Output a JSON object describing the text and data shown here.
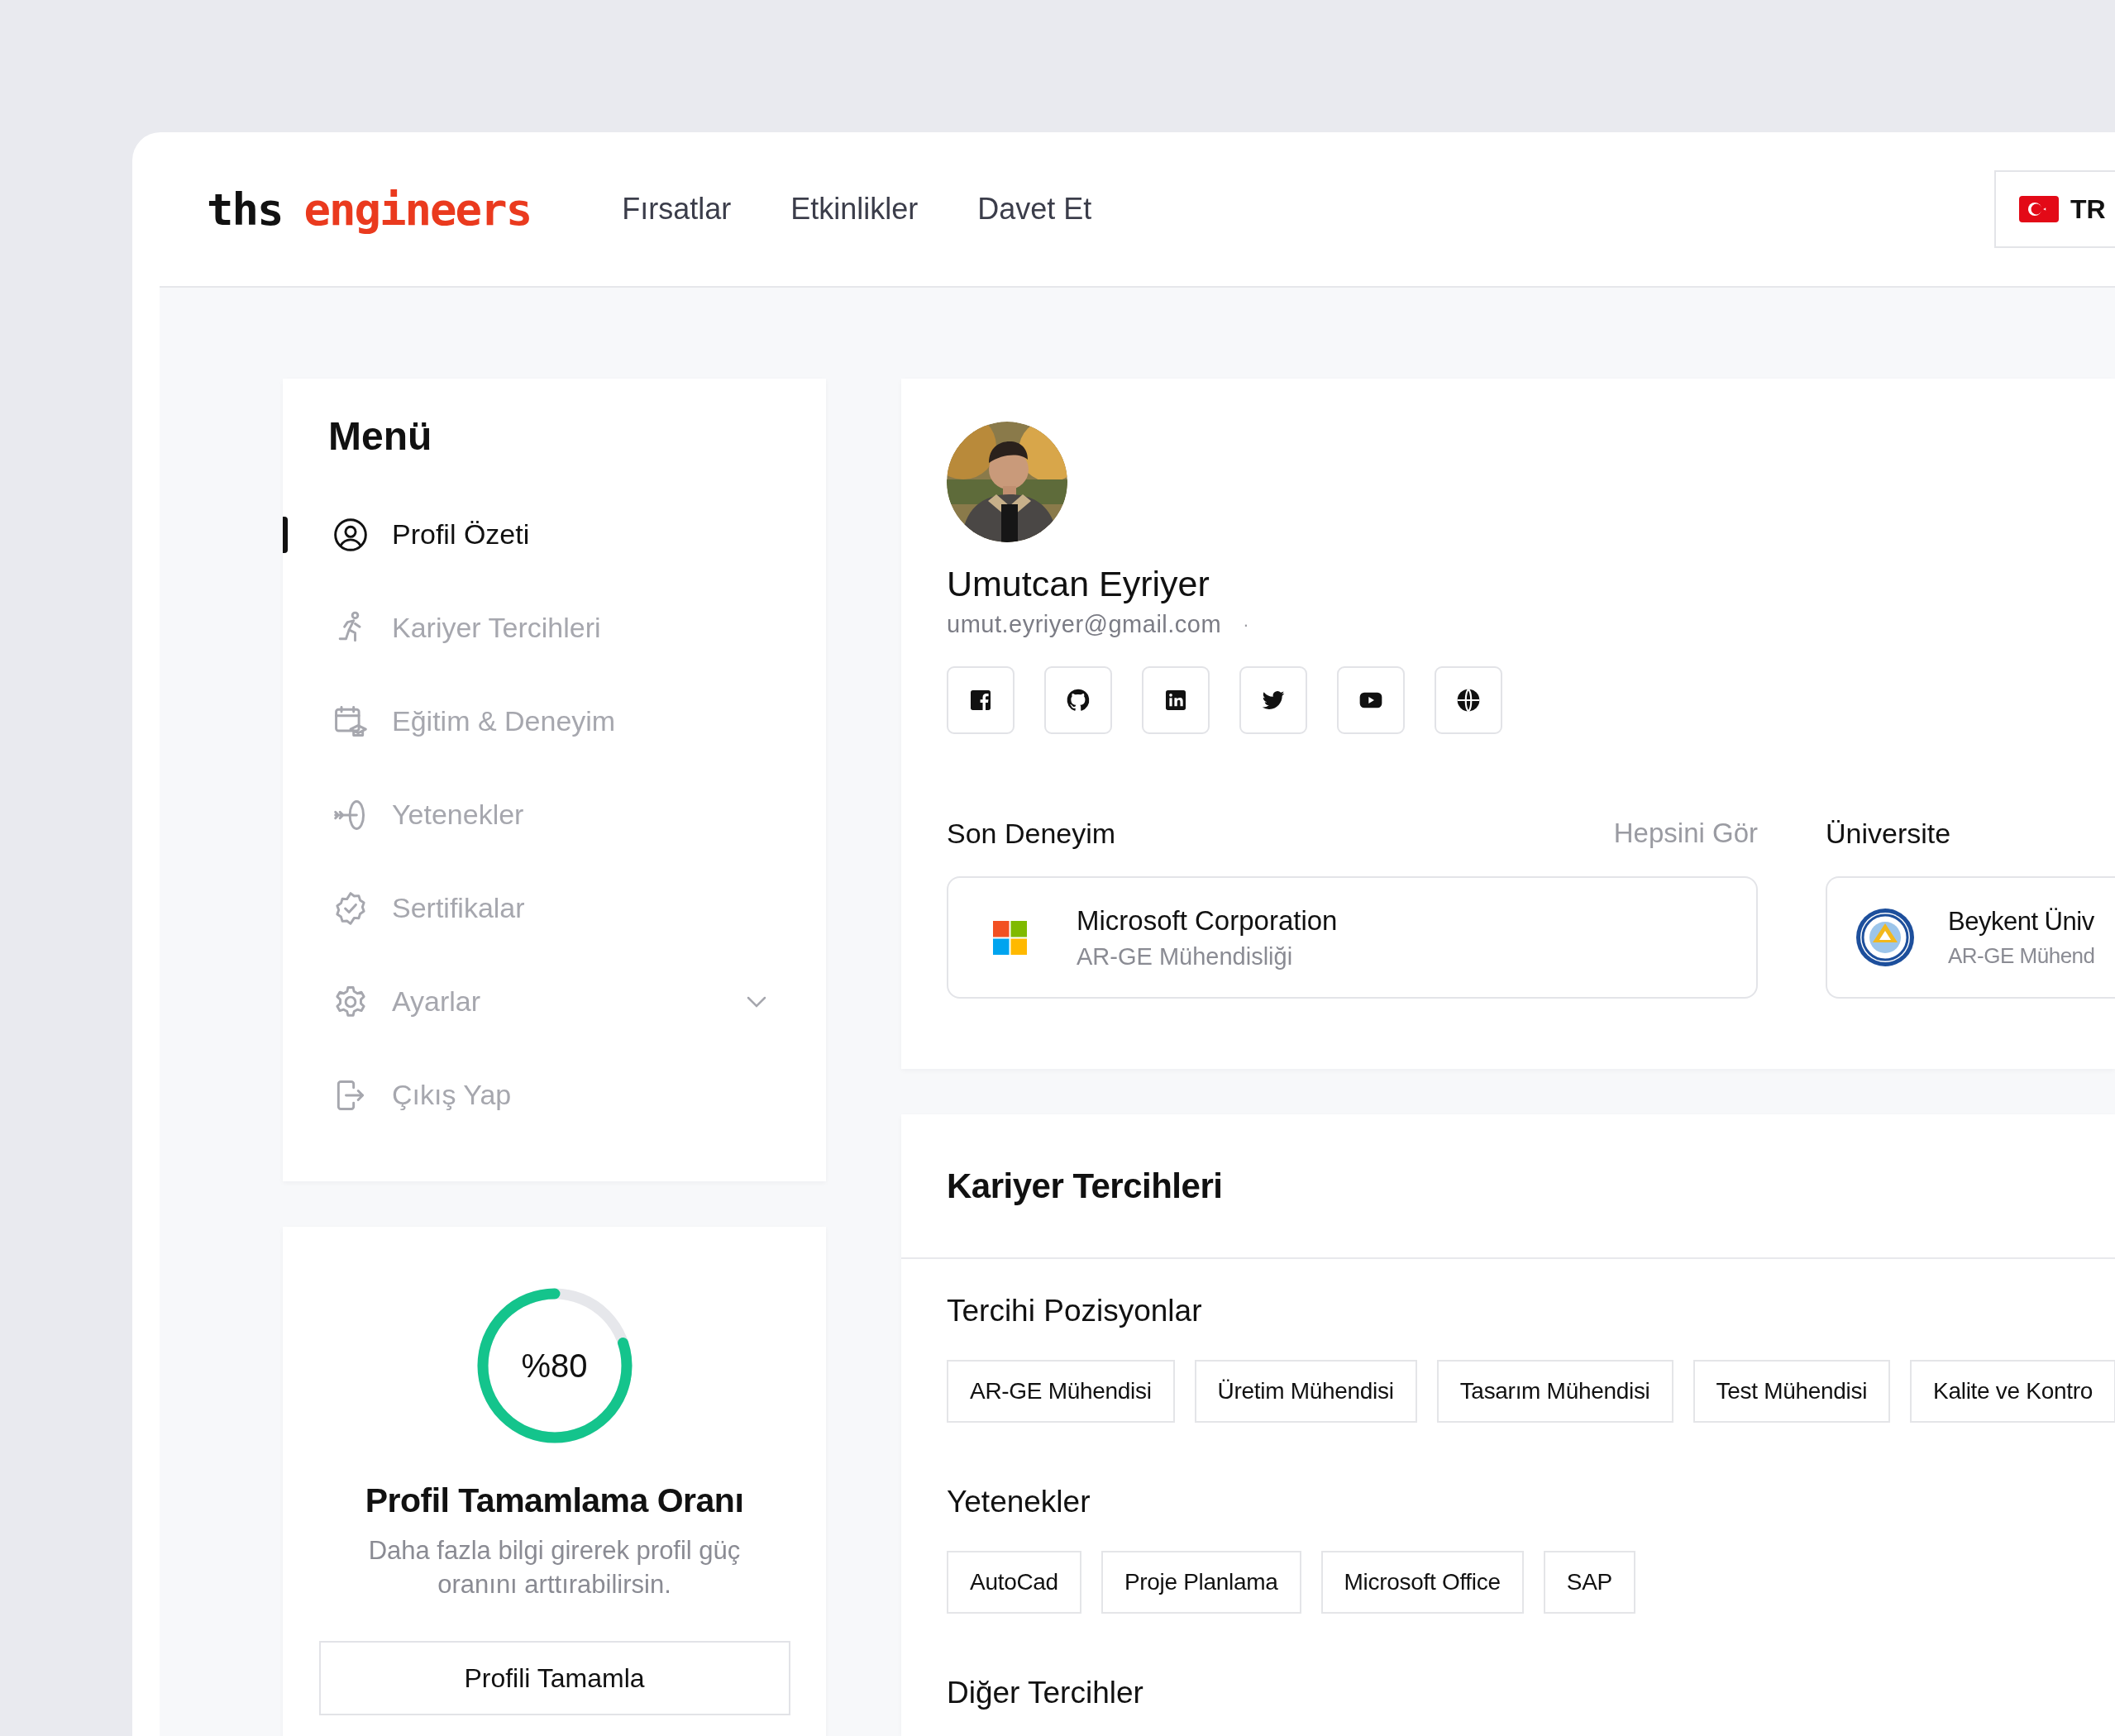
{
  "header": {
    "logo": {
      "prefix": "ths",
      "wordmark": "engineers"
    },
    "nav": [
      {
        "label": "Fırsatlar"
      },
      {
        "label": "Etkinlikler"
      },
      {
        "label": "Davet Et"
      }
    ],
    "language": {
      "code": "TR"
    }
  },
  "menu": {
    "title": "Menü",
    "items": [
      {
        "label": "Profil Özeti",
        "kind": "profile",
        "selected": true
      },
      {
        "label": "Kariyer Tercihleri",
        "kind": "career",
        "selected": false
      },
      {
        "label": "Eğitim & Deneyim",
        "kind": "education",
        "selected": false
      },
      {
        "label": "Yetenekler",
        "kind": "skills",
        "selected": false
      },
      {
        "label": "Sertifikalar",
        "kind": "certificates",
        "selected": false
      },
      {
        "label": "Ayarlar",
        "kind": "settings",
        "selected": false
      },
      {
        "label": "Çıkış Yap",
        "kind": "logout",
        "selected": false
      }
    ]
  },
  "completion": {
    "percent": "%80",
    "level": 0.8,
    "title": "Profil Tamamlama Oranı",
    "description": "Daha fazla bilgi girerek profil güç oranını arttırabilirsin.",
    "button": "Profili Tamamla"
  },
  "profile": {
    "name": "Umutcan Eyriyer",
    "email": "umut.eyriyer@gmail.com",
    "separator": "·",
    "social_links": [
      {
        "kind": "facebook"
      },
      {
        "kind": "github"
      },
      {
        "kind": "linkedin"
      },
      {
        "kind": "twitter"
      },
      {
        "kind": "youtube"
      },
      {
        "kind": "website"
      }
    ],
    "sections": [
      {
        "title": "Son Deneyim",
        "action": "Hepsini Gör",
        "card": {
          "kind": "company",
          "title": "Microsoft Corporation",
          "subtitle": "AR-GE Mühendisliği"
        }
      },
      {
        "title": "Üniversite",
        "card": {
          "kind": "university",
          "title": "Beykent Üniv",
          "subtitle": "AR-GE Mühend"
        }
      }
    ]
  },
  "career": {
    "title": "Kariyer Tercihleri",
    "groups": [
      {
        "title": "Tercihi Pozisyonlar",
        "tags": [
          "AR-GE Mühendisi",
          "Üretim Mühendisi",
          "Tasarım Mühendisi",
          "Test Mühendisi",
          "Kalite ve Kontro"
        ]
      },
      {
        "title": "Yetenekler",
        "tags": [
          "AutoCad",
          "Proje Planlama",
          "Microsoft Office",
          "SAP"
        ]
      },
      {
        "title": "Diğer Tercihler"
      }
    ]
  }
}
